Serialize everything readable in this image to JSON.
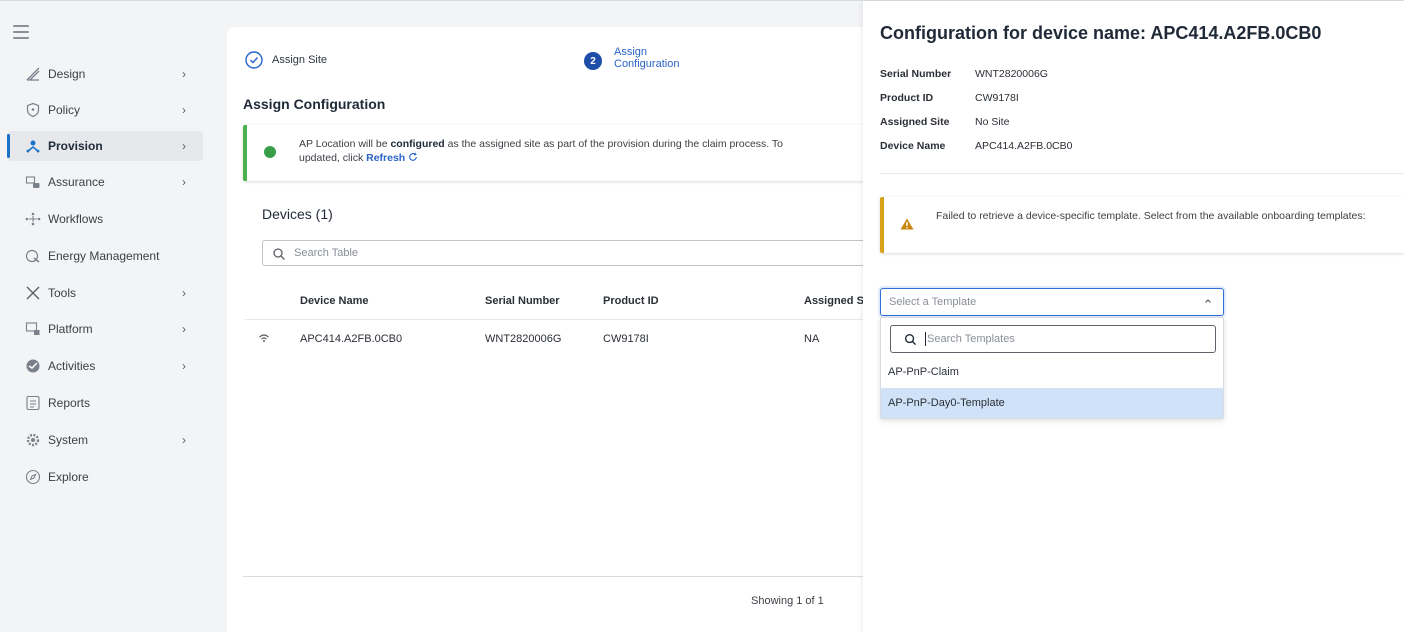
{
  "sidebar": {
    "items": [
      {
        "label": "Design",
        "icon": "design-icon",
        "chevron": true
      },
      {
        "label": "Policy",
        "icon": "shield-icon",
        "chevron": true
      },
      {
        "label": "Provision",
        "icon": "provision-icon",
        "chevron": true,
        "active": true
      },
      {
        "label": "Assurance",
        "icon": "assurance-icon",
        "chevron": true
      },
      {
        "label": "Workflows",
        "icon": "workflow-icon",
        "chevron": false
      },
      {
        "label": "Energy Management",
        "icon": "energy-icon",
        "chevron": false
      },
      {
        "label": "Tools",
        "icon": "tools-icon",
        "chevron": true
      },
      {
        "label": "Platform",
        "icon": "platform-icon",
        "chevron": true
      },
      {
        "label": "Activities",
        "icon": "activities-icon",
        "chevron": true
      },
      {
        "label": "Reports",
        "icon": "reports-icon",
        "chevron": false
      },
      {
        "label": "System",
        "icon": "gear-icon",
        "chevron": true
      },
      {
        "label": "Explore",
        "icon": "compass-icon",
        "chevron": false
      }
    ],
    "chevron_glyph": "›"
  },
  "stepper": {
    "step1_label": "Assign Site",
    "step2_number": "2",
    "step2_label": "Assign Configuration"
  },
  "main": {
    "section_title": "Assign Configuration",
    "alert": {
      "pre": "AP Location will be ",
      "bold": "configured",
      "mid": " as the assigned site as part of the provision during the claim process. To",
      "line2": "updated, click ",
      "link": "Refresh"
    },
    "devices_title": "Devices (1)",
    "search_placeholder": "Search Table",
    "columns": [
      "Device Name",
      "Serial Number",
      "Product ID",
      "Assigned S"
    ],
    "rows": [
      {
        "device_name": "APC414.A2FB.0CB0",
        "serial": "WNT2820006G",
        "product_id": "CW9178I",
        "assigned": "NA"
      }
    ],
    "showing": "Showing 1 of 1"
  },
  "drawer": {
    "title": "Configuration for device name: APC414.A2FB.0CB0",
    "details": [
      {
        "key": "Serial Number",
        "value": "WNT2820006G"
      },
      {
        "key": "Product ID",
        "value": "CW9178I"
      },
      {
        "key": "Assigned Site",
        "value": "No Site"
      },
      {
        "key": "Device Name",
        "value": "APC414.A2FB.0CB0"
      }
    ],
    "warning": "Failed to retrieve a device-specific template. Select from the available onboarding templates:",
    "select_placeholder": "Select a Template",
    "dropdown_search_placeholder": "Search Templates",
    "options": [
      "AP-PnP-Claim",
      "AP-PnP-Day0-Template"
    ],
    "selected_option": "AP-PnP-Day0-Template"
  },
  "colors": {
    "accent": "#1a73c8",
    "success": "#4caf50",
    "warning": "#d9a11a",
    "selected_option_bg": "#cfe2f7"
  }
}
